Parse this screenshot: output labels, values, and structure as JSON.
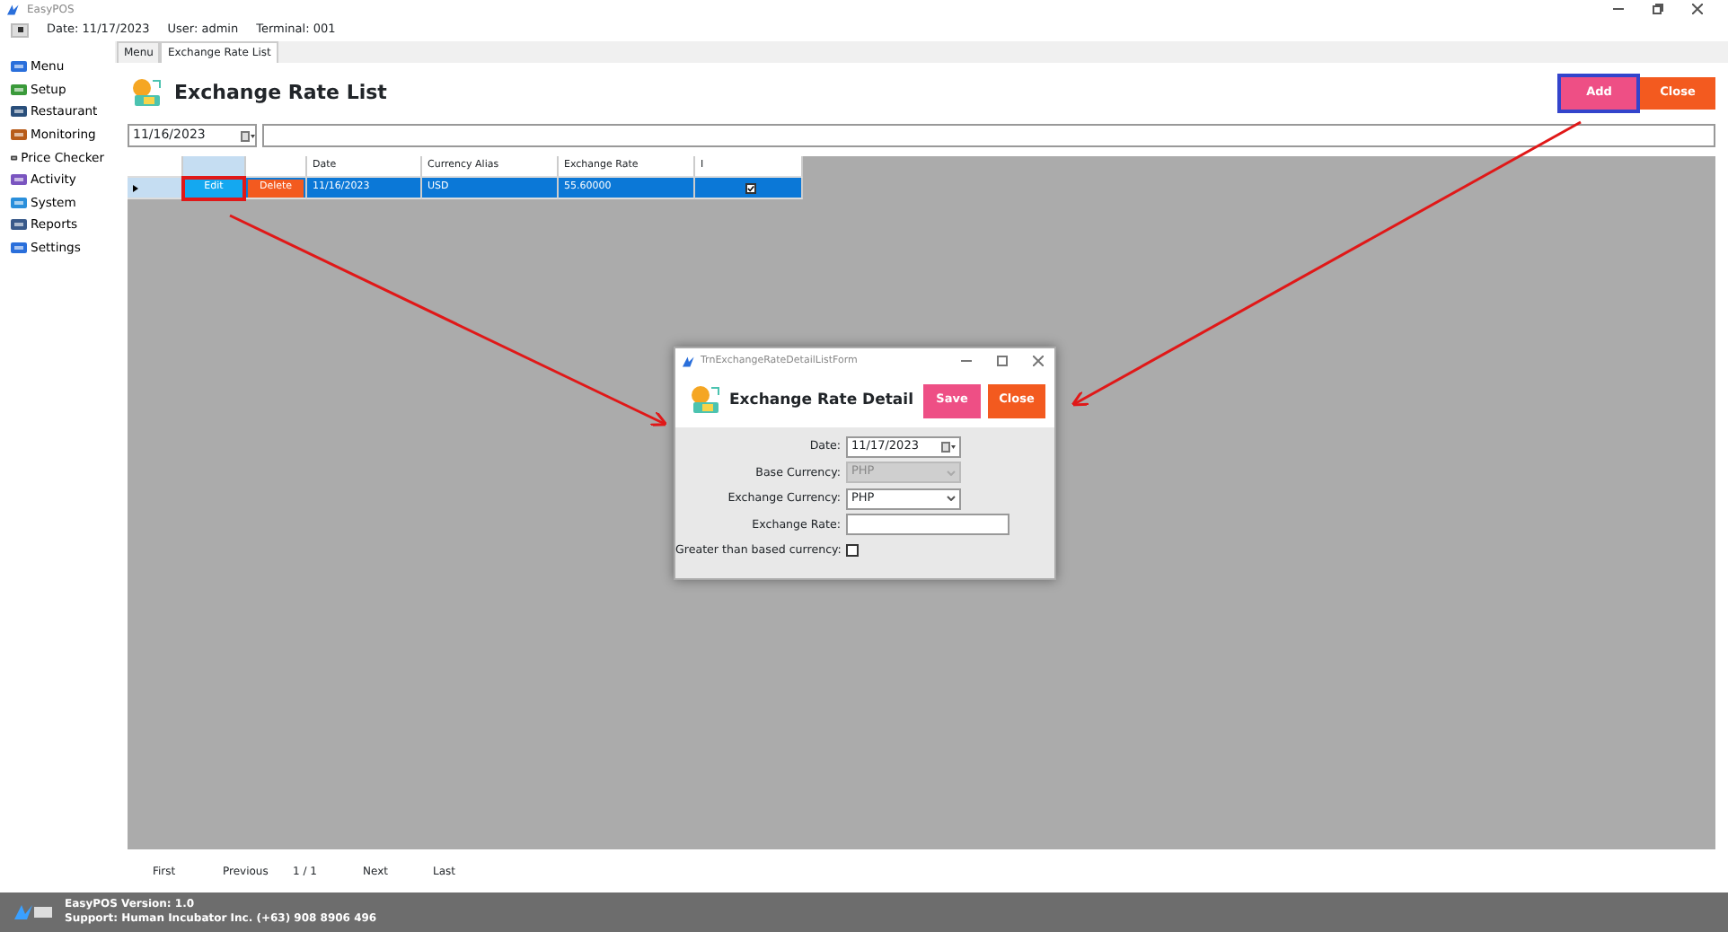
{
  "window": {
    "title": "EasyPOS"
  },
  "info_bar": {
    "date": "Date: 11/17/2023",
    "user": "User: admin",
    "terminal": "Terminal: 001"
  },
  "sidebar": {
    "items": [
      {
        "label": "Menu"
      },
      {
        "label": "Setup"
      },
      {
        "label": "Restaurant"
      },
      {
        "label": "Monitoring"
      },
      {
        "label": "Price Checker"
      },
      {
        "label": "Activity"
      },
      {
        "label": "System"
      },
      {
        "label": "Reports"
      },
      {
        "label": "Settings"
      }
    ]
  },
  "tabs": [
    {
      "label": "Menu",
      "selected": false
    },
    {
      "label": "Exchange Rate List",
      "selected": true
    }
  ],
  "page": {
    "title": "Exchange Rate List",
    "buttons": [
      {
        "label": "Add",
        "kind": "add",
        "focused": true
      },
      {
        "label": "Close",
        "kind": "close",
        "focused": false
      }
    ]
  },
  "filter": {
    "date": "11/16/2023"
  },
  "table": {
    "columns": [
      "Date",
      "Currency Alias",
      "Exchange Rate",
      "I"
    ],
    "rows": [
      {
        "selected": true,
        "edit": "Edit",
        "delete": "Delete",
        "date": "11/16/2023",
        "currency_alias": "USD",
        "exchange_rate": "55.60000",
        "checked": true
      }
    ]
  },
  "pager": {
    "first": "First",
    "previous": "Previous",
    "page": "1 / 1",
    "next": "Next",
    "last": "Last"
  },
  "status_bar": {
    "version": "EasyPOS Version: 1.0",
    "support": "Support: Human Incubator Inc. (+63) 908 8906 496"
  },
  "dialog": {
    "title": "TrnExchangeRateDetailListForm",
    "heading": "Exchange Rate Detail",
    "buttons": [
      {
        "label": "Save",
        "kind": "save"
      },
      {
        "label": "Close",
        "kind": "close"
      }
    ],
    "fields": [
      {
        "label": "Date:",
        "kind": "date",
        "value": "11/17/2023"
      },
      {
        "label": "Base Currency:",
        "kind": "select",
        "value": "PHP",
        "disabled": true
      },
      {
        "label": "Exchange Currency:",
        "kind": "select",
        "value": "PHP",
        "disabled": false
      },
      {
        "label": "Exchange Rate:",
        "kind": "text"
      },
      {
        "label": "Greater than based currency:",
        "kind": "checkbox",
        "checked": false
      }
    ]
  }
}
